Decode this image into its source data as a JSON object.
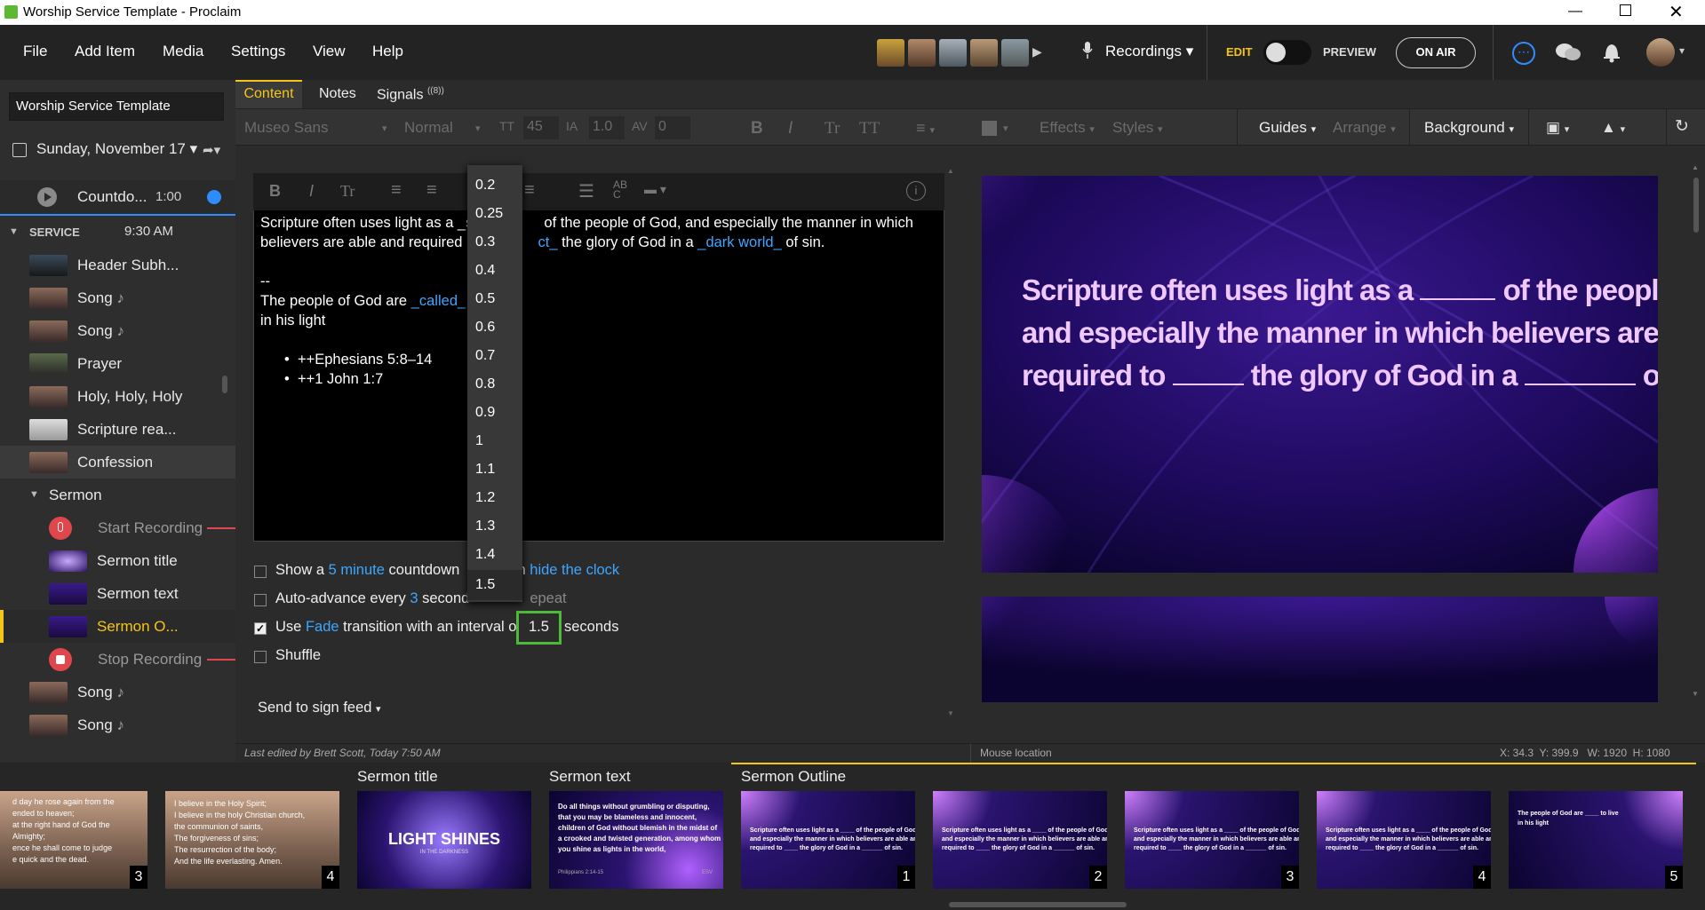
{
  "window": {
    "title": "Worship Service Template - Proclaim"
  },
  "menu": {
    "items": [
      "File",
      "Add Item",
      "Media",
      "Settings",
      "View",
      "Help"
    ],
    "recordings": "Recordings",
    "edit": "EDIT",
    "preview": "PREVIEW",
    "on_air": "ON AIR"
  },
  "sidebar": {
    "presentation_name": "Worship Service Template",
    "date": "Sunday, November 17",
    "countdown": {
      "label": "Countdo...",
      "time": "1:00"
    },
    "section": {
      "label": "SERVICE",
      "time": "9:30 AM"
    },
    "items": [
      "Header Subh...",
      "Song",
      "Song",
      "Prayer",
      "Holy, Holy, Holy",
      "Scripture rea...",
      "Confession"
    ],
    "sermon": {
      "label": "Sermon",
      "start": "Start Recording",
      "title": "Sermon title",
      "text": "Sermon text",
      "outline": "Sermon O...",
      "stop": "Stop Recording"
    },
    "after": [
      "Song",
      "Song"
    ]
  },
  "tabs": [
    "Content",
    "Notes",
    "Signals"
  ],
  "signals_badge": "((8))",
  "toolbar": {
    "font": "Museo Sans",
    "weight": "Normal",
    "size": "45",
    "line_height": "1.0",
    "spacing": "0",
    "effects": "Effects",
    "styles": "Styles",
    "guides": "Guides",
    "arrange": "Arrange",
    "background": "Background"
  },
  "editor": {
    "line1a": "Scripture often uses light as a _s",
    "line1b": "of the people of God, and especially the manner in which",
    "line2a": "believers are able and required",
    "line2b": "ct_",
    "line2c": " the glory of God in a ",
    "line2d": "_dark world_",
    "line2e": " of sin.",
    "sep": "--",
    "line3a": "The people of God are ",
    "line3b": "_called_",
    "line3c": "v",
    "line4": "in his light",
    "bullet1": "++Ephesians 5:8–14",
    "bullet2": "++1 John 1:7"
  },
  "options": {
    "countdown": {
      "a": "Show a ",
      "b": "5 minute",
      "c": " countdown",
      "d": "en ",
      "e": "hide the clock",
      "checked": false
    },
    "autoadvance": {
      "a": "Auto-advance every ",
      "b": "3",
      "c": " second",
      "d": "epeat",
      "checked": false
    },
    "transition": {
      "a": "Use ",
      "b": "Fade",
      "c": " transition with an interval o",
      "d": "1.5",
      "e": "seconds",
      "checked": true
    },
    "shuffle": {
      "a": "Shuffle",
      "checked": false
    }
  },
  "send_to_sign": "Send to sign feed",
  "interval_options": [
    "0.2",
    "0.25",
    "0.3",
    "0.4",
    "0.5",
    "0.6",
    "0.7",
    "0.8",
    "0.9",
    "1",
    "1.1",
    "1.2",
    "1.3",
    "1.4",
    "1.5"
  ],
  "interval_selected": "1.5",
  "slide": {
    "line1a": "Scripture often uses light as a",
    "line1b": "of the people of God,",
    "line2": "and especially the manner in which believers are able and",
    "line3a": "required to",
    "line3b": "the glory of God in a",
    "line3c": "of sin."
  },
  "status": {
    "edited": "Last edited by Brett Scott, Today 7:50 AM",
    "mouse": "Mouse location",
    "coords": "X: 34.3  Y: 399.9   W: 1920  H: 1080"
  },
  "filmstrip": {
    "sections": [
      "Sermon title",
      "Sermon text",
      "Sermon Outline"
    ],
    "nums": [
      "3",
      "4",
      "1",
      "2",
      "3",
      "4",
      "5"
    ],
    "creed3": [
      "d day he rose again from the",
      "ended to heaven;",
      "at the right hand of God the",
      "Almighty;",
      "ence he shall come to judge",
      "e quick and the dead."
    ],
    "creed4": [
      "I believe in the Holy Spirit;",
      "I believe in the holy Christian church,",
      "the communion of saints,",
      "The forgiveness of sins;",
      "The resurrection of the body;",
      "And the life everlasting. Amen."
    ],
    "title_logo": "LIGHT SHINES",
    "title_sub": "IN THE DARKNESS",
    "text_lines": [
      "Do all things without grumbling or disputing,",
      "that you may be blameless and innocent,",
      "children of God without blemish in the midst of",
      "a crooked and twisted generation, among whom",
      "you shine as lights in the world,"
    ],
    "text_ref": "Philippians 2:14-15",
    "text_ver": "ESV",
    "outline_lines": [
      "Scripture often uses light as a ____ of the people of God,",
      "and especially the manner in which believers are able and",
      "required to ____ the glory of God in a ______ of sin."
    ],
    "outline5": [
      "The people of God are ____ to live",
      "in his light"
    ]
  }
}
